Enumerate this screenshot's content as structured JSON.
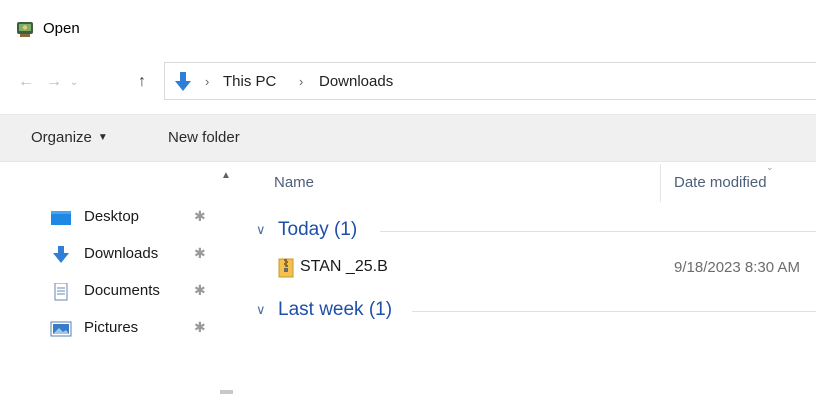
{
  "window": {
    "title": "Open",
    "icon": "open-dialog-app-icon"
  },
  "navigation": {
    "back_icon": "arrow-left-icon",
    "forward_icon": "arrow-right-icon",
    "recent_icon": "chevron-down-icon",
    "up_icon": "arrow-up-icon",
    "separator": "›"
  },
  "address_bar": {
    "icon": "downloads-arrow-icon",
    "breadcrumbs": [
      "This PC",
      "Downloads"
    ]
  },
  "command_bar": {
    "organize_label": "Organize",
    "organize_caret": "▼",
    "new_folder_label": "New folder"
  },
  "sidebar": {
    "items": [
      {
        "label": "Desktop",
        "icon": "desktop-icon",
        "pinned": true
      },
      {
        "label": "Downloads",
        "icon": "downloads-icon",
        "pinned": true
      },
      {
        "label": "Documents",
        "icon": "documents-icon",
        "pinned": true
      },
      {
        "label": "Pictures",
        "icon": "pictures-icon",
        "pinned": true
      }
    ],
    "pin_glyph": "✱"
  },
  "file_list": {
    "columns": {
      "name": "Name",
      "date_modified": "Date modified"
    },
    "groups": [
      {
        "label": "Today (1)",
        "files": [
          {
            "name": "STAN _25.B",
            "date_modified": "9/18/2023 8:30 AM",
            "icon": "zip-archive-icon"
          }
        ]
      },
      {
        "label": "Last week (1)",
        "files": []
      }
    ]
  },
  "colors": {
    "accent_blue": "#1e4fa8",
    "header_text": "#4c607a",
    "command_bar_bg": "#f0f0f0"
  }
}
